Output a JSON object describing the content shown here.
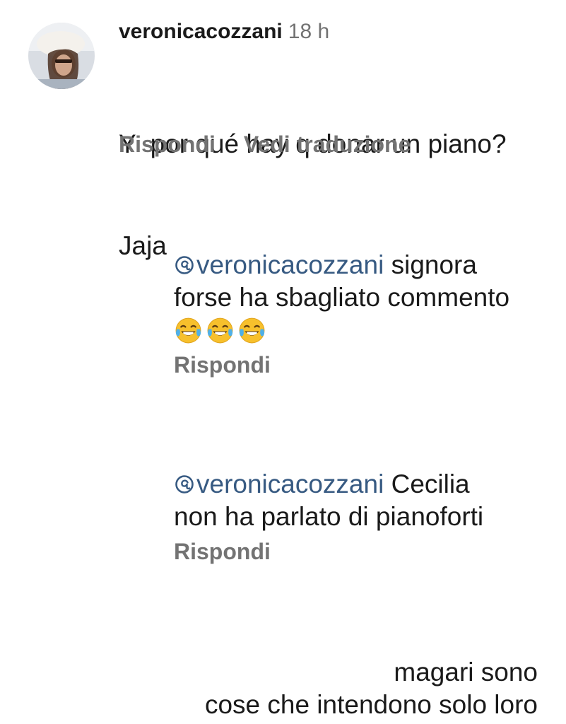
{
  "comment": {
    "username": "veronicacozzani",
    "timestamp": "18 h",
    "text_lines": [
      "Y  por qué hay q donar un piano?",
      "Jaja"
    ],
    "actions": {
      "reply": "Rispondi",
      "translate": "Vedi traduzione"
    }
  },
  "replies": [
    {
      "mention": "veronicacozzani",
      "line1_rest": " signora",
      "line2": "forse ha sbagliato commento",
      "emoji_count": 3,
      "emoji_name": "face-with-tears-of-joy",
      "reply_label": "Rispondi"
    },
    {
      "mention": "veronicacozzani",
      "line1_rest": " Cecilia",
      "line2": "non ha parlato di pianoforti",
      "reply_label": "Rispondi"
    }
  ],
  "trailing_text": {
    "line1": "magari sono",
    "line2": "cose che intendono solo loro"
  },
  "colors": {
    "text": "#1a1a1a",
    "secondary": "#737373",
    "mention": "#375a82",
    "background": "#ffffff"
  },
  "icons": {
    "mention": "threads-icon",
    "emoji": "face-with-tears-of-joy-icon"
  }
}
